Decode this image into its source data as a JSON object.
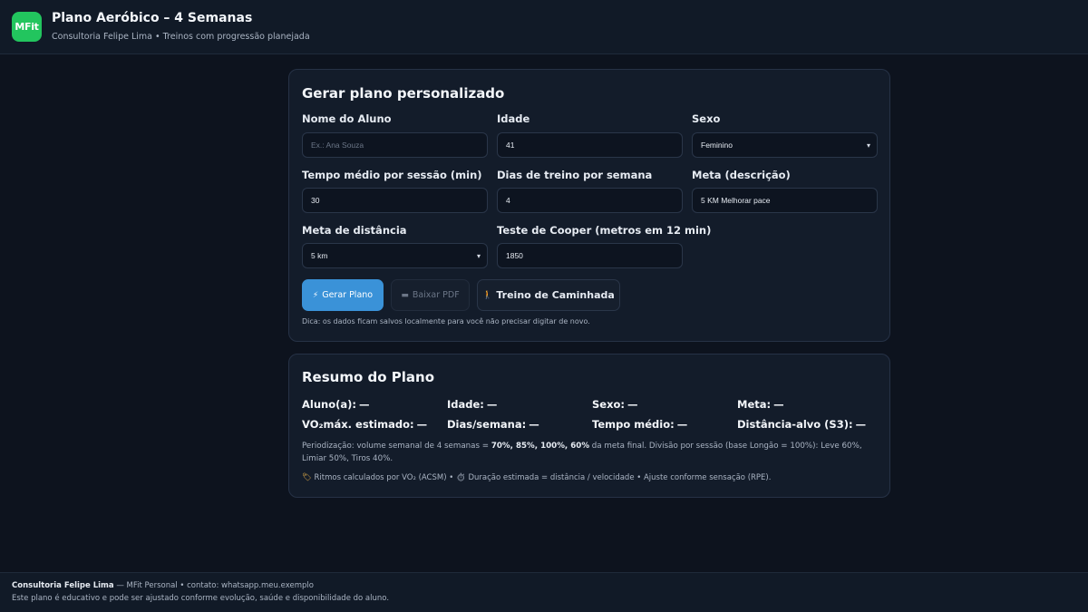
{
  "header": {
    "logo_text": "MFit",
    "title": "Plano Aeróbico – 4 Semanas",
    "subtitle": "Consultoria Felipe Lima • Treinos com progressão planejada"
  },
  "form": {
    "title": "Gerar plano personalizado",
    "fields": {
      "nome": {
        "label": "Nome do Aluno",
        "value": "",
        "placeholder": "Ex.: Ana Souza"
      },
      "idade": {
        "label": "Idade",
        "value": "41"
      },
      "sexo": {
        "label": "Sexo",
        "value": "Feminino"
      },
      "tempo": {
        "label": "Tempo médio por sessão (min)",
        "value": "30"
      },
      "dias": {
        "label": "Dias de treino por semana",
        "value": "4"
      },
      "meta": {
        "label": "Meta (descrição)",
        "value": "5 KM Melhorar pace"
      },
      "meta_distancia": {
        "label": "Meta de distância",
        "value": "5 km"
      },
      "cooper": {
        "label": "Teste de Cooper (metros em 12 min)",
        "value": "1850"
      }
    },
    "buttons": {
      "gerar": "Gerar Plano",
      "gerar_icon": "⚡",
      "baixar": "Baixar PDF",
      "baixar_icon": "▬",
      "caminhada": "Treino de Caminhada",
      "caminhada_icon": "🚶"
    },
    "hint": "Dica: os dados ficam salvos localmente para você não precisar digitar de novo."
  },
  "summary": {
    "title": "Resumo do Plano",
    "items": [
      {
        "label": "Aluno(a):",
        "value": "—"
      },
      {
        "label": "Idade:",
        "value": "—"
      },
      {
        "label": "Sexo:",
        "value": "—"
      },
      {
        "label": "Meta:",
        "value": "—"
      },
      {
        "label": "VO₂máx. estimado:",
        "value": "—"
      },
      {
        "label": "Dias/semana:",
        "value": "—"
      },
      {
        "label": "Tempo médio:",
        "value": "—"
      },
      {
        "label": "Distância-alvo (S3):",
        "value": "—"
      }
    ],
    "periodization": {
      "prefix": "Periodização: volume semanal de 4 semanas = ",
      "bold": "70%, 85%, 100%, 60%",
      "suffix": " da meta final. Divisão por sessão (base Longão = 100%): Leve 60%, Limiar 50%, Tiros 40%."
    },
    "notes_icon_1": "🏷",
    "notes_text": " Ritmos calculados por VO₂ (ACSM) • ",
    "notes_icon_2": "⏱",
    "notes_text_2": " Duração estimada = distância / velocidade • Ajuste conforme sensação (RPE)."
  },
  "footer": {
    "brand": "Consultoria Felipe Lima",
    "line1_rest": " — MFit Personal • contato: whatsapp.meu.exemplo",
    "line2": "Este plano é educativo e pode ser ajustado conforme evolução, saúde e disponibilidade do aluno."
  }
}
